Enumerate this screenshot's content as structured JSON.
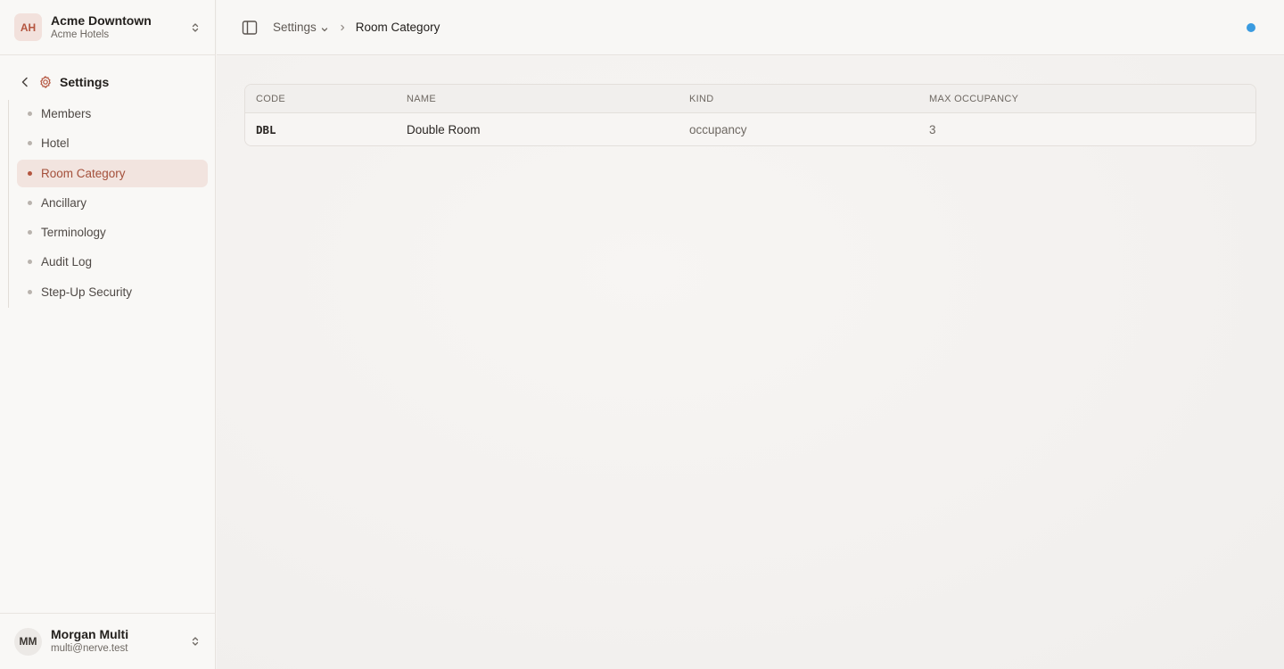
{
  "org": {
    "initials": "AH",
    "name": "Acme Downtown",
    "company": "Acme Hotels"
  },
  "settings": {
    "title": "Settings"
  },
  "nav": {
    "items": [
      {
        "label": "Members"
      },
      {
        "label": "Hotel"
      },
      {
        "label": "Room Category"
      },
      {
        "label": "Ancillary"
      },
      {
        "label": "Terminology"
      },
      {
        "label": "Audit Log"
      },
      {
        "label": "Step-Up Security"
      }
    ],
    "active": "Room Category"
  },
  "user": {
    "initials": "MM",
    "name": "Morgan Multi",
    "email": "multi@nerve.test"
  },
  "breadcrumb": {
    "parent": "Settings",
    "current": "Room Category"
  },
  "table": {
    "columns": [
      "CODE",
      "NAME",
      "KIND",
      "MAX OCCUPANCY"
    ],
    "rows": [
      {
        "code": "DBL",
        "name": "Double Room",
        "kind": "occupancy",
        "max_occupancy": "3"
      }
    ]
  },
  "colors": {
    "accent": "#b4553f",
    "status": "#3a9be0"
  },
  "icons": [
    "chevron-up-down-icon",
    "chevron-left-icon",
    "gear-icon",
    "sidebar-toggle-icon",
    "chevron-down-icon",
    "chevron-right-icon"
  ]
}
